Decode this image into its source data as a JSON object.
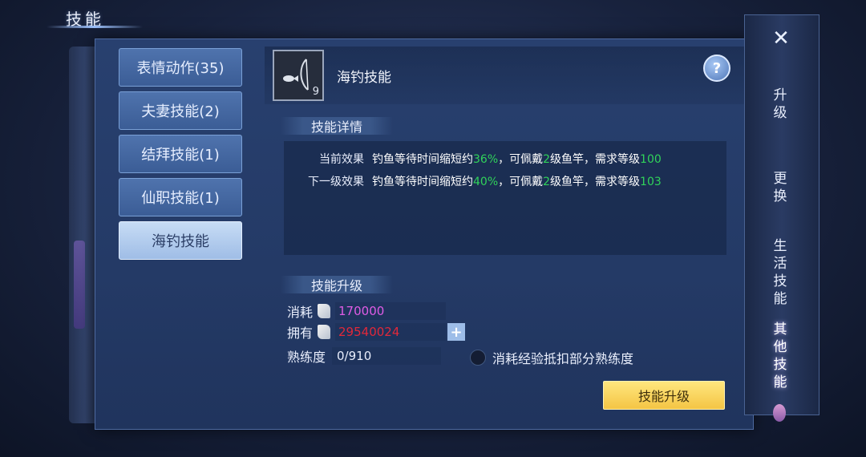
{
  "window": {
    "title": "技能"
  },
  "left_tabs": [
    {
      "label": "表情动作(35)"
    },
    {
      "label": "夫妻技能(2)"
    },
    {
      "label": "结拜技能(1)"
    },
    {
      "label": "仙职技能(1)"
    },
    {
      "label": "海钓技能",
      "active": true
    }
  ],
  "skill": {
    "name": "海钓技能",
    "icon": "fishing-rod-icon",
    "level": "9",
    "help_label": "?"
  },
  "details": {
    "title": "技能详情",
    "current": {
      "label": "当前效果",
      "text1": "钓鱼等待时间缩短约",
      "pct": "36%",
      "text2": "，可佩戴",
      "count": "2",
      "text3": "级鱼竿，需求等级",
      "req": "100"
    },
    "next": {
      "label": "下一级效果",
      "text1": "钓鱼等待时间缩短约",
      "pct": "40%",
      "text2": "，可佩戴",
      "count": "2",
      "text3": "级鱼竿，需求等级",
      "req": "103"
    }
  },
  "upgrade": {
    "title": "技能升级",
    "cost_label": "消耗",
    "cost_value": "170000",
    "own_label": "拥有",
    "own_value": "29540024",
    "plus_label": "+",
    "proficiency_label": "熟练度",
    "proficiency_value": "0/910",
    "checkbox_label": "消耗经验抵扣部分熟练度",
    "button_label": "技能升级"
  },
  "colors": {
    "cost": "#e05ce6",
    "own": "#e0283a",
    "green": "#30d35a"
  },
  "side_tabs": [
    {
      "label": "升级"
    },
    {
      "label": "更换"
    },
    {
      "label": "生活技能"
    },
    {
      "label": "其他技能",
      "active": true
    }
  ],
  "close_label": "✕"
}
